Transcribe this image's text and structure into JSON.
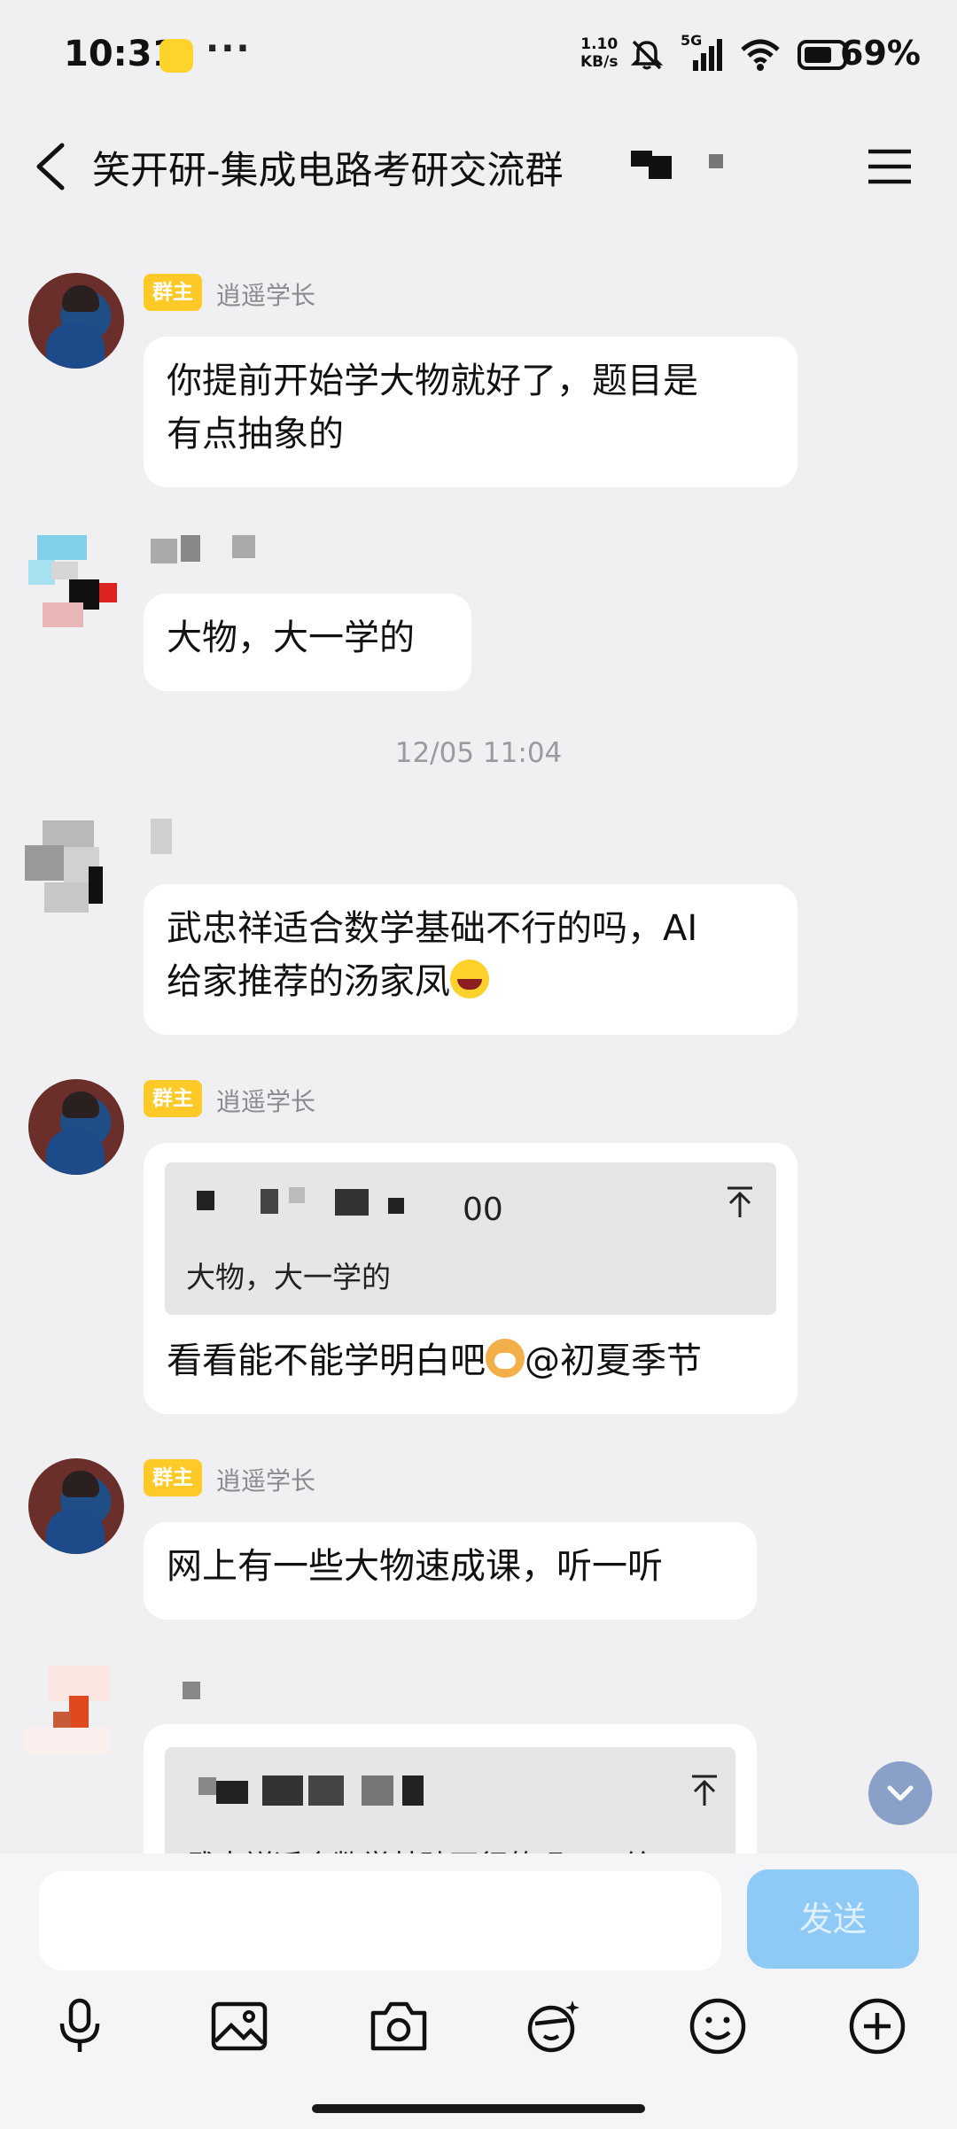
{
  "status_bar": {
    "time": "10:31",
    "speed_value": "1.10",
    "speed_unit": "KB/s",
    "network": "5G",
    "battery": "69%"
  },
  "header": {
    "title": "笑开研-集成电路考研交流群",
    "back_icon": "chevron-left-icon",
    "menu_icon": "hamburger-menu-icon"
  },
  "messages": [
    {
      "sender": "逍遥学长",
      "role_tag": "群主",
      "text_line1": "你提前开始学大物就好了，题目是",
      "text_line2": "有点抽象的"
    },
    {
      "sender": "",
      "text_line1": "大物，大一学的"
    },
    {
      "sender": "",
      "text_line1": "武忠祥适合数学基础不行的吗，AI",
      "text_line2": "给家推荐的汤家凤"
    },
    {
      "sender": "逍遥学长",
      "role_tag": "群主",
      "quote_header_tail": "00",
      "quote_text": "大物，大一学的",
      "text_line1": "看看能不能学明白吧",
      "mention": "@初夏季节"
    },
    {
      "sender": "逍遥学长",
      "role_tag": "群主",
      "text_line1": "网上有一些大物速成课，听一听"
    },
    {
      "sender": "",
      "quote_text": "武忠祥适合数学基础不行的吗，AI给"
    }
  ],
  "timestamp": "12/05 11:04",
  "composer": {
    "placeholder": "",
    "send_label": "发送",
    "tools": [
      "microphone-icon",
      "image-icon",
      "camera-icon",
      "sticker-icon",
      "emoji-icon",
      "plus-icon"
    ]
  },
  "colors": {
    "background": "#f0f0f3",
    "bubble": "#ffffff",
    "owner_tag": "#ffca28",
    "send_button": "#8fc9f5"
  }
}
